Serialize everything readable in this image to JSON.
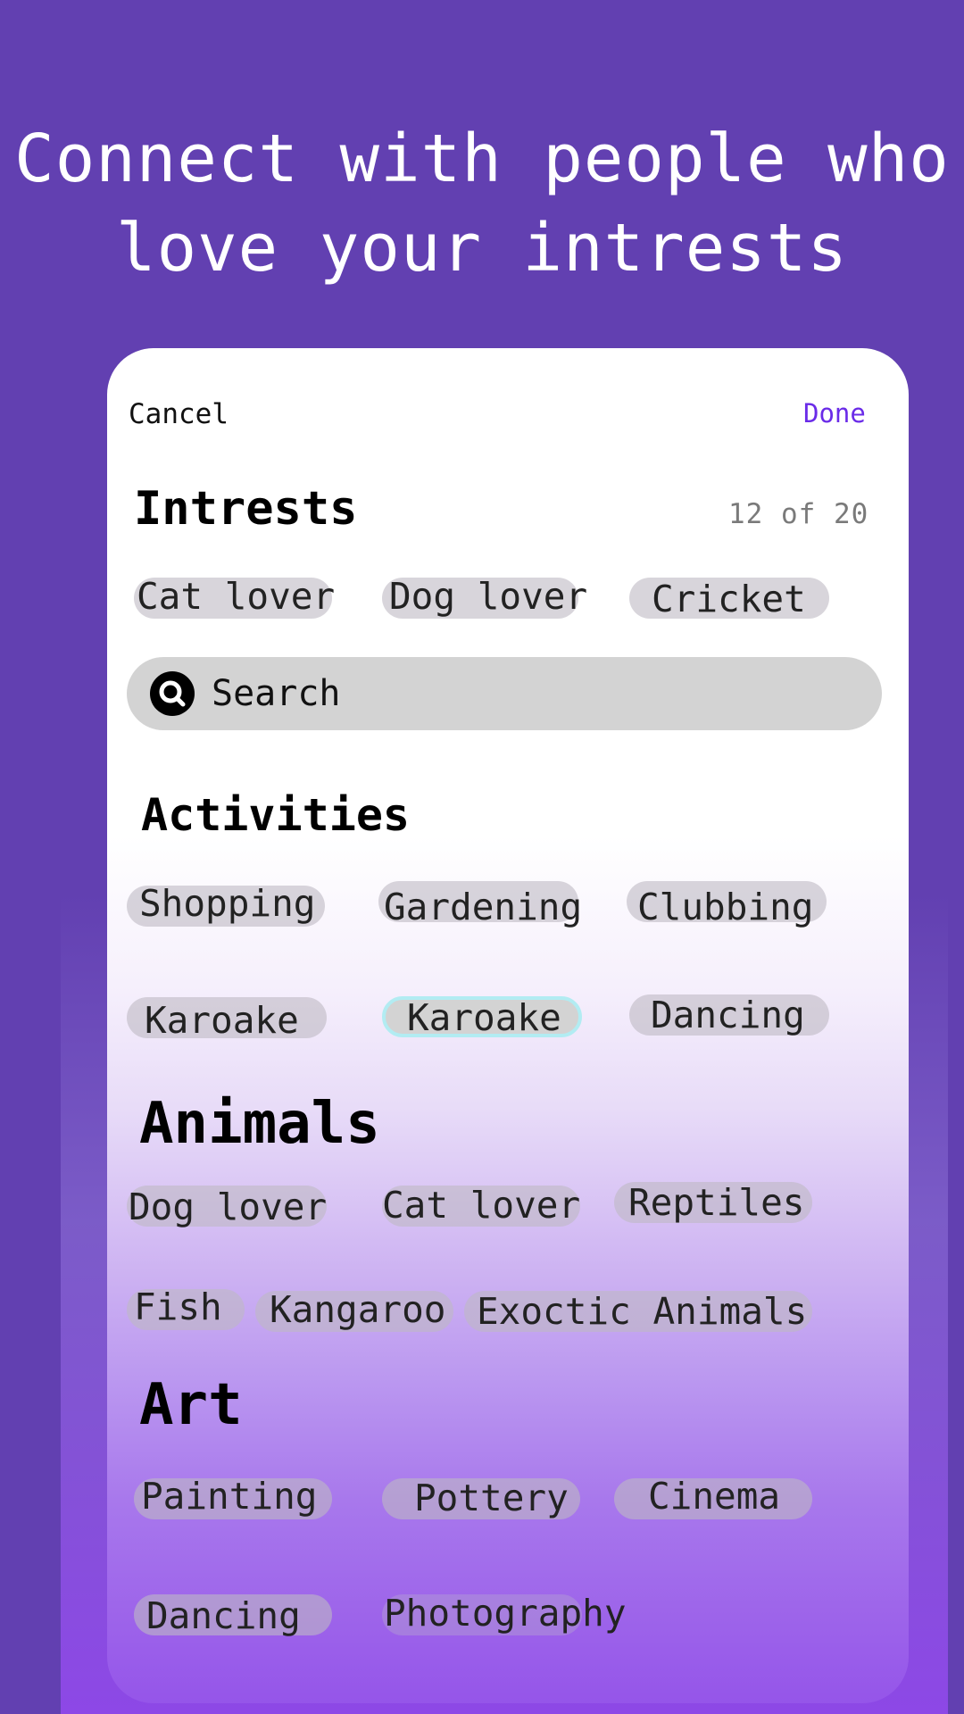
{
  "headline": {
    "line1": "Connect with people who",
    "line2": "love your intrests"
  },
  "card": {
    "cancel_label": "Cancel",
    "done_label": "Done",
    "interests": {
      "title": "Intrests",
      "count": "12 of 20",
      "chips": [
        "Cat lover",
        "Dog lover",
        "Cricket"
      ]
    },
    "search": {
      "placeholder": "Search",
      "icon": "search-icon"
    },
    "activities": {
      "title": "Activities",
      "chips": [
        "Shopping",
        "Gardening",
        "Clubbing",
        "Karoake",
        "Karoake",
        "Dancing"
      ]
    },
    "animals": {
      "title": "Animals",
      "chips": [
        "Dog lover",
        "Cat lover",
        "Reptiles",
        "Fish",
        "Kangaroo",
        "Exoctic Animals"
      ]
    },
    "art": {
      "title": "Art",
      "chips": [
        "Painting",
        "Pottery",
        "Cinema",
        "Dancing",
        "Photography"
      ]
    }
  },
  "colors": {
    "background": "#6240b1",
    "accent": "#6a2be8",
    "chip": "#d3d3d3",
    "selected_outline": "#b2ecf2"
  }
}
